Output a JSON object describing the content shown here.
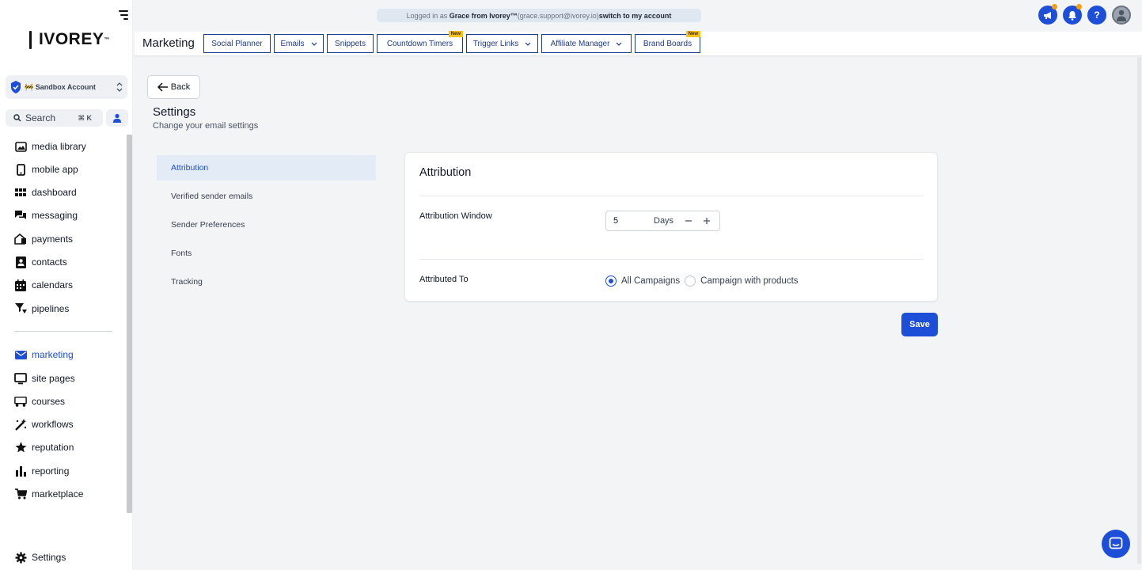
{
  "app": {
    "logo_text": "IVOREY",
    "logo_tm": "™"
  },
  "sidebar": {
    "account_name": "🚧 Sandbox Account",
    "search_placeholder": "Search",
    "search_shortcut": "⌘ K",
    "items": [
      {
        "label": "media library",
        "icon": "image-icon"
      },
      {
        "label": "mobile app",
        "icon": "phone-icon"
      },
      {
        "label": "dashboard",
        "icon": "grid-icon"
      },
      {
        "label": "messaging",
        "icon": "chat-icon"
      },
      {
        "label": "payments",
        "icon": "payments-icon"
      },
      {
        "label": "contacts",
        "icon": "contact-card-icon"
      },
      {
        "label": "calendars",
        "icon": "calendar-icon"
      },
      {
        "label": "pipelines",
        "icon": "funnel-icon"
      }
    ],
    "items2": [
      {
        "label": "marketing",
        "icon": "mail-icon",
        "active": true
      },
      {
        "label": "site pages",
        "icon": "monitor-icon"
      },
      {
        "label": "courses",
        "icon": "courses-icon"
      },
      {
        "label": "workflows",
        "icon": "magic-wand-icon"
      },
      {
        "label": "reputation",
        "icon": "star-icon"
      },
      {
        "label": "reporting",
        "icon": "bar-chart-icon"
      },
      {
        "label": "marketplace",
        "icon": "cart-icon"
      }
    ],
    "settings_label": "Settings",
    "accent_color": "#1d4ed8"
  },
  "banner": {
    "prefix": "Logged in as ",
    "user": "Grace from Ivorey™",
    "email": " (grace.support@ivorey.io) ",
    "action": "switch to my account"
  },
  "header": {
    "section_title": "Marketing",
    "tabs": [
      {
        "label": "Social Planner"
      },
      {
        "label": "Emails",
        "dropdown": true
      },
      {
        "label": "Snippets"
      },
      {
        "label": "Countdown Timers",
        "badge": "New"
      },
      {
        "label": "Trigger Links",
        "dropdown": true
      },
      {
        "label": "Affiliate Manager",
        "dropdown": true
      },
      {
        "label": "Brand Boards",
        "badge": "New"
      }
    ]
  },
  "main": {
    "back_label": "Back",
    "title": "Settings",
    "subtitle": "Change your email settings",
    "menu": [
      {
        "label": "Attribution",
        "active": true
      },
      {
        "label": "Verified sender emails"
      },
      {
        "label": "Sender Preferences"
      },
      {
        "label": "Fonts"
      },
      {
        "label": "Tracking"
      }
    ],
    "card": {
      "title": "Attribution",
      "window_label": "Attribution Window",
      "window_value": "5",
      "window_unit": "Days",
      "attributed_label": "Attributed To",
      "options": [
        {
          "label": "All Campaigns",
          "checked": true
        },
        {
          "label": "Campaign with products",
          "checked": false
        }
      ]
    },
    "save_label": "Save"
  }
}
